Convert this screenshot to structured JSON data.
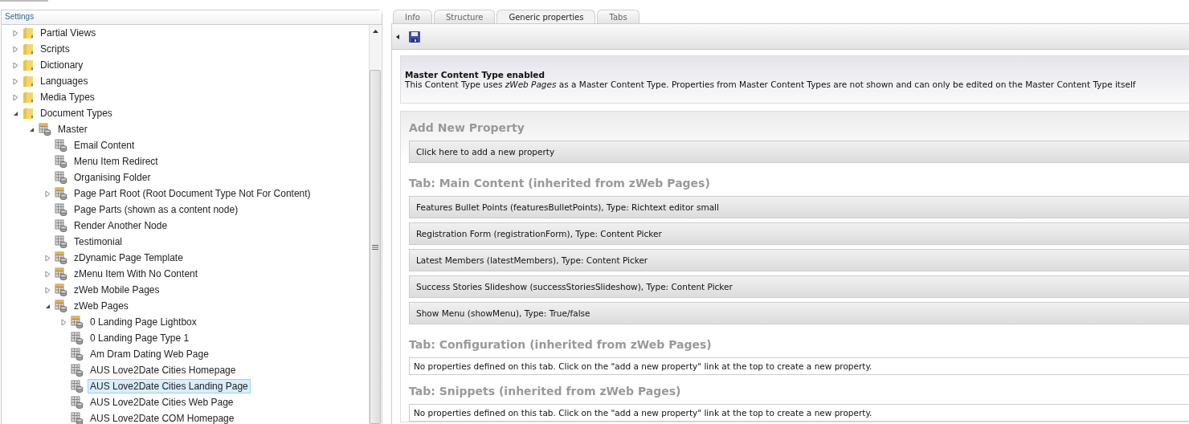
{
  "sidebar": {
    "title": "Settings",
    "tree": [
      {
        "label": "Partial Views",
        "kind": "folder",
        "expanded": false,
        "selected": false
      },
      {
        "label": "Scripts",
        "kind": "folder",
        "expanded": false,
        "selected": false
      },
      {
        "label": "Dictionary",
        "kind": "folder",
        "expanded": false,
        "selected": false
      },
      {
        "label": "Languages",
        "kind": "folder",
        "expanded": false,
        "selected": false
      },
      {
        "label": "Media Types",
        "kind": "folder",
        "expanded": false,
        "selected": false
      },
      {
        "label": "Document Types",
        "kind": "folder",
        "expanded": true,
        "selected": false,
        "children": [
          {
            "label": "Master",
            "kind": "doctype",
            "expanded": true,
            "selected": false,
            "children": [
              {
                "label": "Email Content",
                "kind": "doctype",
                "selected": false
              },
              {
                "label": "Menu Item Redirect",
                "kind": "doctype",
                "selected": false
              },
              {
                "label": "Organising Folder",
                "kind": "doctype",
                "selected": false
              },
              {
                "label": "Page Part Root (Root Document Type Not For Content)",
                "kind": "doctype",
                "expanded": false,
                "selected": false
              },
              {
                "label": "Page Parts (shown as a content node)",
                "kind": "doctype",
                "selected": false
              },
              {
                "label": "Render Another Node",
                "kind": "doctype",
                "selected": false
              },
              {
                "label": "Testimonial",
                "kind": "doctype",
                "selected": false
              },
              {
                "label": "zDynamic Page Template",
                "kind": "doctype",
                "expanded": false,
                "selected": false
              },
              {
                "label": "zMenu Item With No Content",
                "kind": "doctype",
                "expanded": false,
                "selected": false
              },
              {
                "label": "zWeb Mobile Pages",
                "kind": "doctype",
                "expanded": false,
                "selected": false
              },
              {
                "label": "zWeb Pages",
                "kind": "doctype",
                "expanded": true,
                "selected": false,
                "children": [
                  {
                    "label": "0 Landing Page Lightbox",
                    "kind": "doctype",
                    "expanded": false,
                    "selected": false
                  },
                  {
                    "label": "0 Landing Page Type 1",
                    "kind": "doctype",
                    "selected": false
                  },
                  {
                    "label": "Am Dram Dating Web Page",
                    "kind": "doctype",
                    "selected": false
                  },
                  {
                    "label": "AUS Love2Date Cities Homepage",
                    "kind": "doctype",
                    "selected": false
                  },
                  {
                    "label": "AUS Love2Date Cities Landing Page",
                    "kind": "doctype",
                    "selected": true
                  },
                  {
                    "label": "AUS Love2Date Cities Web Page",
                    "kind": "doctype",
                    "selected": false
                  },
                  {
                    "label": "AUS Love2Date COM Homepage",
                    "kind": "doctype",
                    "selected": false
                  }
                ]
              }
            ]
          }
        ]
      }
    ]
  },
  "tabs": [
    {
      "label": "Info",
      "selected": false
    },
    {
      "label": "Structure",
      "selected": false
    },
    {
      "label": "Generic properties",
      "selected": true
    },
    {
      "label": "Tabs",
      "selected": false
    }
  ],
  "master_notice": {
    "title": "Master Content Type enabled",
    "text": "This Content Type uses *zWeb Pages* as a Master Content Type. Properties from Master Content Types are not shown and can only be edited on the Master Content Type itself"
  },
  "add_property": {
    "heading": "Add New Property",
    "link": "Click here to add a new property"
  },
  "sections": [
    {
      "heading": "Tab: Main Content (inherited from zWeb Pages)",
      "properties": [
        "Features Bullet Points (featuresBulletPoints), Type: Richtext editor small",
        "Registration Form (registrationForm), Type: Content Picker",
        "Latest Members (latestMembers), Type: Content Picker",
        "Success Stories Slideshow (successStoriesSlideshow), Type: Content Picker",
        "Show Menu (showMenu), Type: True/false"
      ]
    },
    {
      "heading": "Tab: Configuration (inherited from zWeb Pages)",
      "empty_note": "No properties defined on this tab. Click on the \"add a new property\" link at the top to create a new property."
    },
    {
      "heading": "Tab: Snippets (inherited from zWeb Pages)",
      "empty_note": "No properties defined on this tab. Click on the \"add a new property\" link at the top to create a new property."
    }
  ]
}
